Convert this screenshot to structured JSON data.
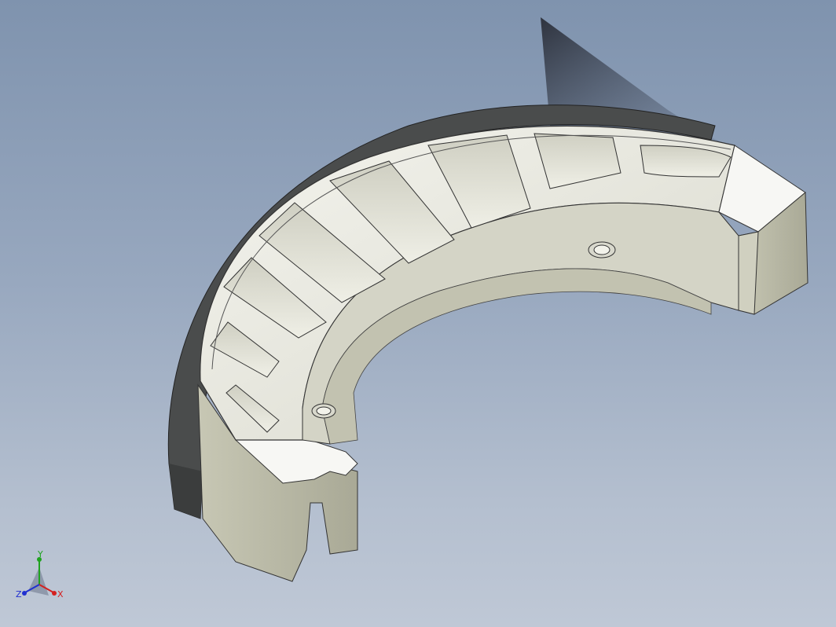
{
  "viewport": {
    "background_top": "#7f93ae",
    "background_bottom": "#bfc8d6"
  },
  "model": {
    "part": "brake-shoe",
    "lining_color": "#4a4c4c",
    "body_color": "#e6e6dc",
    "side_face_color": "#b8b8a6"
  },
  "triad": {
    "x_label": "X",
    "y_label": "Y",
    "z_label": "Z",
    "x_color": "#d42020",
    "y_color": "#1fa31f",
    "z_color": "#2030d0"
  }
}
